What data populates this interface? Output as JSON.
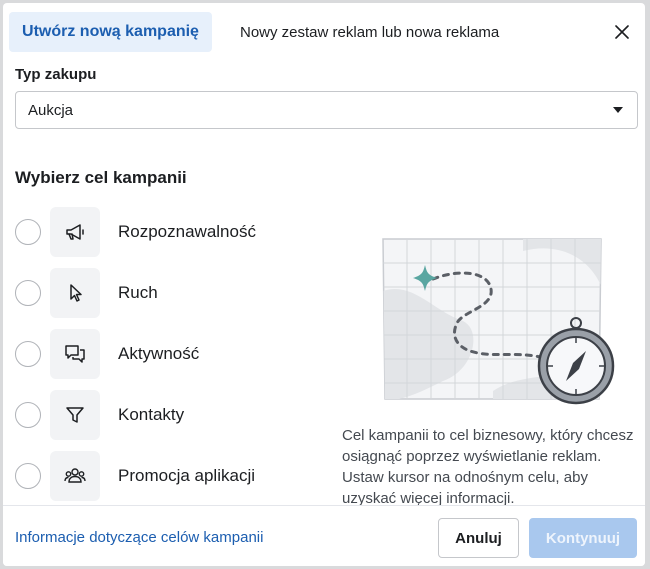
{
  "header": {
    "active_tab": "Utwórz nową kampanię",
    "other_tab": "Nowy zestaw reklam lub nowa reklama",
    "close_icon": "close-icon"
  },
  "purchase": {
    "label": "Typ zakupu",
    "selected": "Aukcja"
  },
  "objectives": {
    "title": "Wybierz cel kampanii",
    "items": [
      {
        "label": "Rozpoznawalność",
        "icon": "megaphone-icon"
      },
      {
        "label": "Ruch",
        "icon": "cursor-icon"
      },
      {
        "label": "Aktywność",
        "icon": "chat-bubbles-icon"
      },
      {
        "label": "Kontakty",
        "icon": "funnel-icon"
      },
      {
        "label": "Promocja aplikacji",
        "icon": "people-icon"
      }
    ],
    "description": "Cel kampanii to cel biznesowy, który chcesz osiągnąć poprzez wyświetlanie reklam. Ustaw kursor na odnośnym celu, aby uzyskać więcej informacji."
  },
  "footer": {
    "info_link": "Informacje dotyczące celów kampanii",
    "cancel": "Anuluj",
    "continue": "Kontynuuj"
  },
  "colors": {
    "accent": "#1c5eb0",
    "active_tab_bg": "#e7f0fb",
    "disabled_button": "#a9c8ee",
    "map_pin": "#5aa6a1"
  }
}
